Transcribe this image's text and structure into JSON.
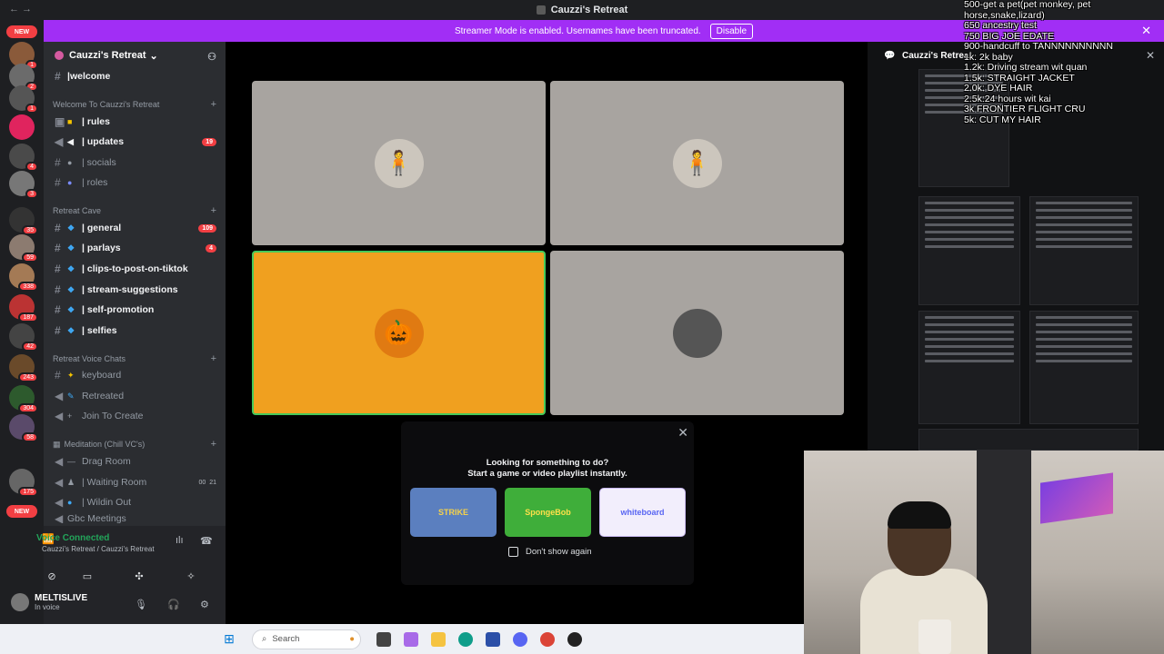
{
  "window": {
    "title": "Cauzzi's Retreat",
    "nav": "←  →"
  },
  "banner": {
    "text": "Streamer Mode is enabled. Usernames have been truncated.",
    "disable": "Disable",
    "close": "✕"
  },
  "server_rail": {
    "new_top": "NEW",
    "new_bottom": "NEW",
    "badges": [
      "1",
      "2",
      "1",
      "4",
      "3",
      "35",
      "59",
      "338",
      "187",
      "42",
      "243",
      "304",
      "58",
      "175"
    ]
  },
  "guild": {
    "name": "Cauzzi's Retreat",
    "chevron": "⌄"
  },
  "channels": {
    "welcome": "|welcome",
    "cat_welcome": "Welcome To Cauzzi's Retreat",
    "rules": "| rules",
    "updates": "| updates",
    "updates_count": "19",
    "socials": "| socials",
    "roles": "| roles",
    "cat_retreat": "Retreat Cave",
    "general": "| general",
    "general_count": "109",
    "parlays": "| parlays",
    "parlays_count": "4",
    "clips": "| clips-to-post-on-tiktok",
    "stream": "| stream-suggestions",
    "promo": "| self-promotion",
    "selfies": "| selfies",
    "cat_voice": "Retreat Voice Chats",
    "keyboard": "keyboard",
    "retreated": "Retreated",
    "join": "Join To Create",
    "cat_meditation": "Meditation (Chill VC's)",
    "drag": "Drag Room",
    "waiting": "| Waiting Room",
    "waiting_count_a": "00",
    "waiting_count_b": "21",
    "wildin": "| Wildin Out",
    "gbc": "Gbc Meetings"
  },
  "voice": {
    "status": "Voice Connected",
    "location": "Cauzzi's Retreat / Cauzzi's Retreat",
    "user": "MELTISLIVE",
    "user_status": "In voice"
  },
  "activity": {
    "line1": "Looking for something to do?",
    "line2": "Start a game or video playlist instantly.",
    "card1": "STRIKE",
    "card2": "SpongeBob",
    "card3": "whiteboard",
    "dont_show": "Don't show again",
    "close": "✕"
  },
  "right_panel": {
    "title": "Cauzzi's Retreat",
    "close": "✕"
  },
  "overlay": [
    "500-get a pet(pet monkey, pet horse,snake,lizard)",
    "650 ancestry test",
    "750 BIG JOE EDATE",
    "900-handcuff to TANNNNNNNNNN",
    "1k: 2k baby",
    "1.2k: Driving stream wit quan",
    "1.5k: STRAIGHT JACKET",
    "2.0k: DYE HAIR",
    "2.5k:24 hours wit kai",
    "3k FRONTIER FLIGHT CRU",
    "5k: CUT MY HAIR"
  ],
  "taskbar": {
    "search": "Search"
  },
  "colors": {
    "banner": "#a12ef5",
    "active_tile": "#f0a01f",
    "speaking": "#45c95a",
    "badge": "#f23f43"
  }
}
